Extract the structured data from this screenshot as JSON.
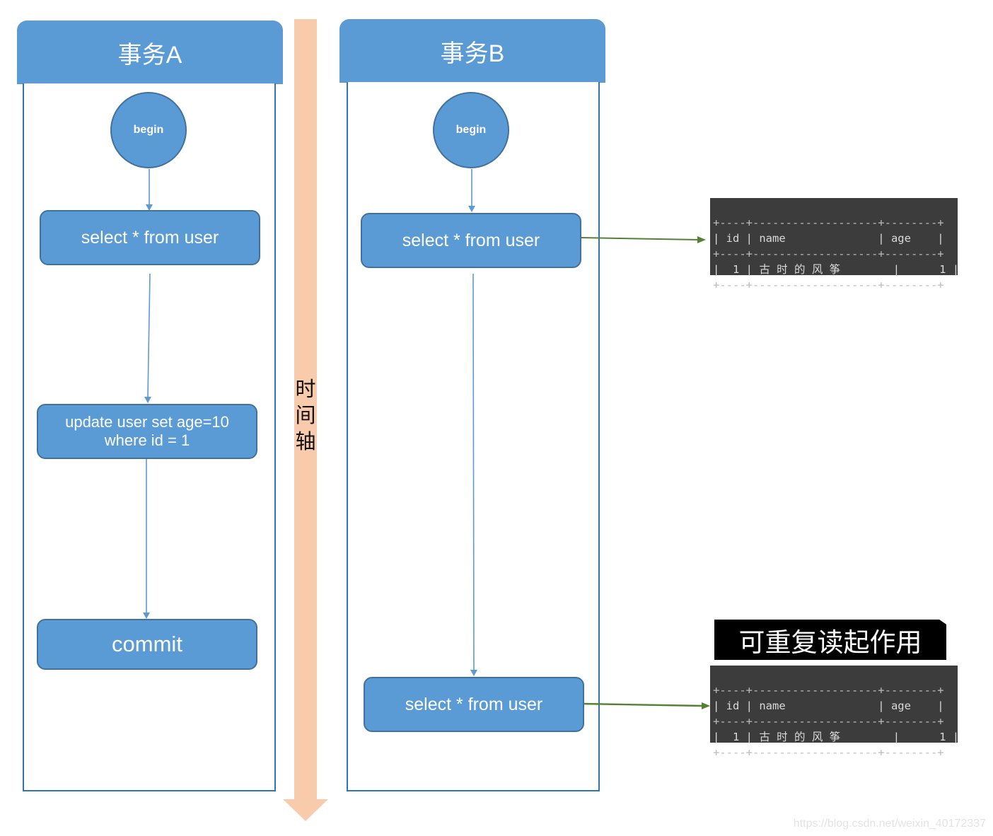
{
  "timeline": {
    "label_chars": [
      "时",
      "间",
      "轴"
    ],
    "color": "#f8cbad"
  },
  "lanes": [
    {
      "title": "事务A",
      "begin_label": "begin",
      "steps": [
        {
          "lines": [
            "select * from user"
          ]
        },
        {
          "lines": [
            "update user set age=10",
            "where id = 1"
          ]
        },
        {
          "lines": [
            "commit"
          ]
        }
      ]
    },
    {
      "title": "事务B",
      "begin_label": "begin",
      "steps": [
        {
          "lines": [
            "select * from user"
          ]
        },
        {
          "lines": [
            "select * from user"
          ]
        }
      ]
    }
  ],
  "results": [
    {
      "border": "+----+-------------------+--------+",
      "header": "| id | name              | age    |",
      "row": "|  1 | 古 时 的 风 筝        |      1 |"
    },
    {
      "border": "+----+-------------------+--------+",
      "header": "| id | name              | age    |",
      "row": "|  1 | 古 时 的 风 筝        |      1 |"
    }
  ],
  "note": "可重复读起作用",
  "colors": {
    "node_fill": "#5b9bd5",
    "lane_border": "#2e75b6",
    "flow_arrow": "#5b9bd5",
    "result_arrow": "#548235"
  },
  "watermark": "https://blog.csdn.net/weixin_40172337"
}
